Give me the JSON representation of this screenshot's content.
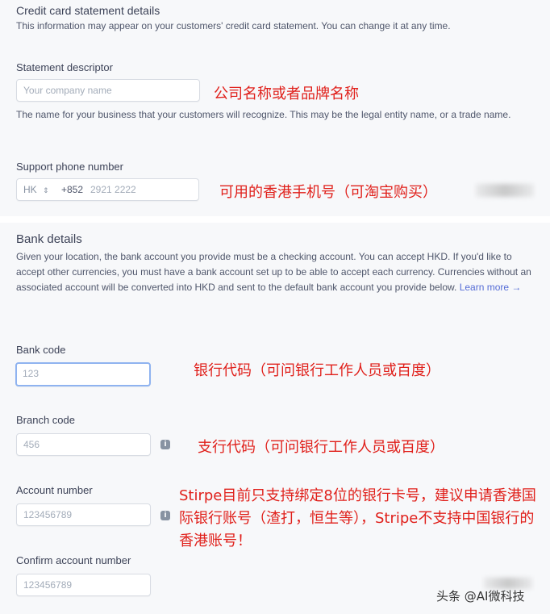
{
  "statement": {
    "title": "Credit card statement details",
    "intro": "This information may appear on your customers' credit card statement. You can change it at any time.",
    "descriptor_label": "Statement descriptor",
    "descriptor_placeholder": "Your company name",
    "descriptor_note": "公司名称或者品牌名称",
    "descriptor_help": "The name for your business that your customers will recognize. This may be the legal entity name, or a trade name.",
    "phone_label": "Support phone number",
    "phone_country": "HK",
    "phone_chevron": "⇕",
    "phone_prefix": "+852",
    "phone_placeholder": "2921 2222",
    "phone_note": "可用的香港手机号（可淘宝购买）"
  },
  "bank": {
    "title": "Bank details",
    "intro": "Given your location, the bank account you provide must be a checking account. You can accept HKD. If you'd like to accept other currencies, you must have a bank account set up to be able to accept each currency. Currencies without an associated account will be converted into HKD and sent to the default bank account you provide below.",
    "learn_more": "Learn more →",
    "bank_code_label": "Bank code",
    "bank_code_placeholder": "123",
    "bank_code_note": "银行代码（可问银行工作人员或百度）",
    "branch_code_label": "Branch code",
    "branch_code_placeholder": "456",
    "branch_code_note": "支行代码（可问银行工作人员或百度）",
    "account_label": "Account number",
    "account_placeholder": "123456789",
    "account_note": "Stirpe目前只支持绑定8位的银行卡号，建议申请香港国际银行账号（渣打，恒生等），Stripe不支持中国银行的香港账号！",
    "confirm_label": "Confirm account number",
    "confirm_placeholder": "123456789",
    "info_glyph": "i"
  },
  "watermark": "头条 @AI微科技"
}
